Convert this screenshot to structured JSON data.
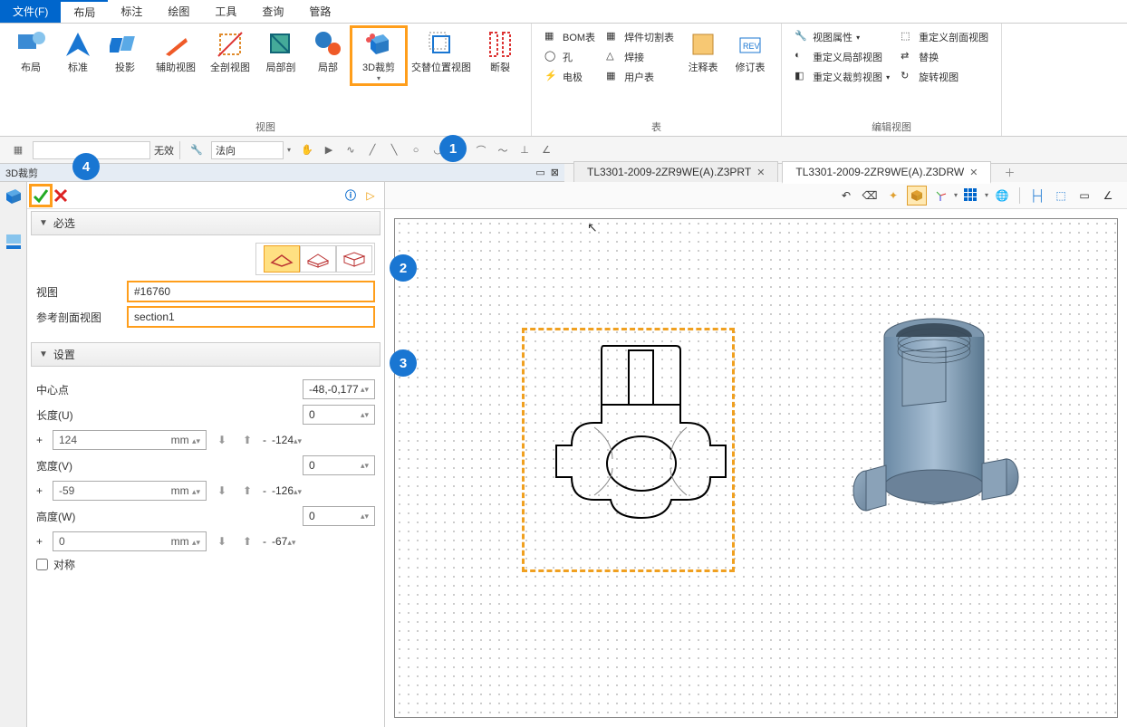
{
  "menu": {
    "file": "文件(F)",
    "tabs": [
      "布局",
      "标注",
      "绘图",
      "工具",
      "查询",
      "管路"
    ],
    "active": 0
  },
  "ribbon": {
    "group_view": "视图",
    "group_table": "表",
    "group_editview": "编辑视图",
    "btn_layout": "布局",
    "btn_standard": "标准",
    "btn_project": "投影",
    "btn_aux": "辅助视图",
    "btn_fullsection": "全剖视图",
    "btn_localsection": "局部剖",
    "btn_local": "局部",
    "btn_3dclip": "3D裁剪",
    "btn_altpos": "交替位置视图",
    "btn_break": "断裂",
    "btn_bom": "BOM表",
    "btn_hole": "孔",
    "btn_electrode": "电极",
    "btn_weldcut": "焊件切割表",
    "btn_weld": "焊接",
    "btn_user": "用户表",
    "btn_annotate": "注释表",
    "btn_revision": "修订表",
    "btn_viewprop": "视图属性",
    "btn_redef_local": "重定义局部视图",
    "btn_redef_clip": "重定义裁剪视图",
    "btn_redef_section": "重定义剖面视图",
    "btn_replace": "替换",
    "btn_rotate": "旋转视图"
  },
  "toolbar2": {
    "invalid": "无效",
    "normal": "法向"
  },
  "panel": {
    "title": "3D裁剪",
    "required": "必选",
    "field_view": "视图",
    "val_view": "#16760",
    "field_refsec": "参考剖面视图",
    "val_refsec": "section1",
    "settings": "设置",
    "center": "中心点",
    "center_val": "-48,-0,177",
    "lenU": "长度(U)",
    "lenU_val": "0",
    "lenU_plus": "124",
    "lenU_minus": "-124",
    "widV": "宽度(V)",
    "widV_val": "0",
    "widV_plus": "-59",
    "widV_minus": "-126",
    "hgtW": "高度(W)",
    "hgtW_val": "0",
    "hgtW_plus": "0",
    "hgtW_minus": "-67",
    "unit": "mm",
    "sym": "对称"
  },
  "tabs": {
    "t1": "TL3301-2009-2ZR9WE(A).Z3PRT",
    "t2": "TL3301-2009-2ZR9WE(A).Z3DRW"
  },
  "callouts": {
    "c1": "1",
    "c2": "2",
    "c3": "3",
    "c4": "4"
  }
}
